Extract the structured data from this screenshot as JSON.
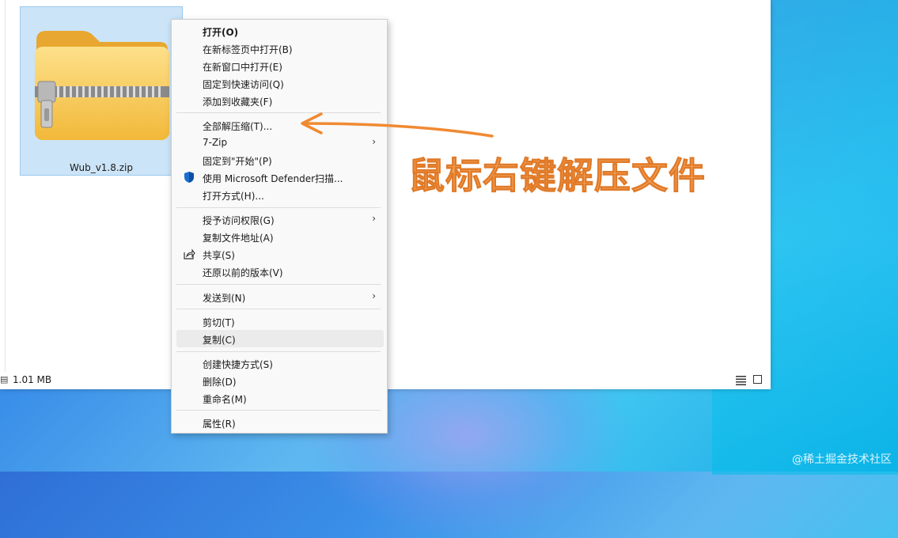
{
  "file": {
    "name": "Wub_v1.8.zip",
    "icon": "zip-folder-icon"
  },
  "status_bar": {
    "size": "1.01 MB"
  },
  "context_menu": {
    "items": [
      {
        "label": "打开(O)"
      },
      {
        "label": "在新标签页中打开(B)"
      },
      {
        "label": "在新窗口中打开(E)"
      },
      {
        "label": "固定到快速访问(Q)"
      },
      {
        "label": "添加到收藏夹(F)"
      },
      {
        "label": "全部解压缩(T)..."
      },
      {
        "label": "7-Zip"
      },
      {
        "label": "固定到\"开始\"(P)"
      },
      {
        "label": "使用 Microsoft Defender扫描..."
      },
      {
        "label": "打开方式(H)..."
      },
      {
        "label": "授予访问权限(G)"
      },
      {
        "label": "复制文件地址(A)"
      },
      {
        "label": "共享(S)"
      },
      {
        "label": "还原以前的版本(V)"
      },
      {
        "label": "发送到(N)"
      },
      {
        "label": "剪切(T)"
      },
      {
        "label": "复制(C)"
      },
      {
        "label": "创建快捷方式(S)"
      },
      {
        "label": "删除(D)"
      },
      {
        "label": "重命名(M)"
      },
      {
        "label": "属性(R)"
      }
    ]
  },
  "annotation": {
    "text": "鼠标右键解压文件",
    "color": "#f5a35a"
  },
  "watermark": "@稀土掘金技术社区"
}
